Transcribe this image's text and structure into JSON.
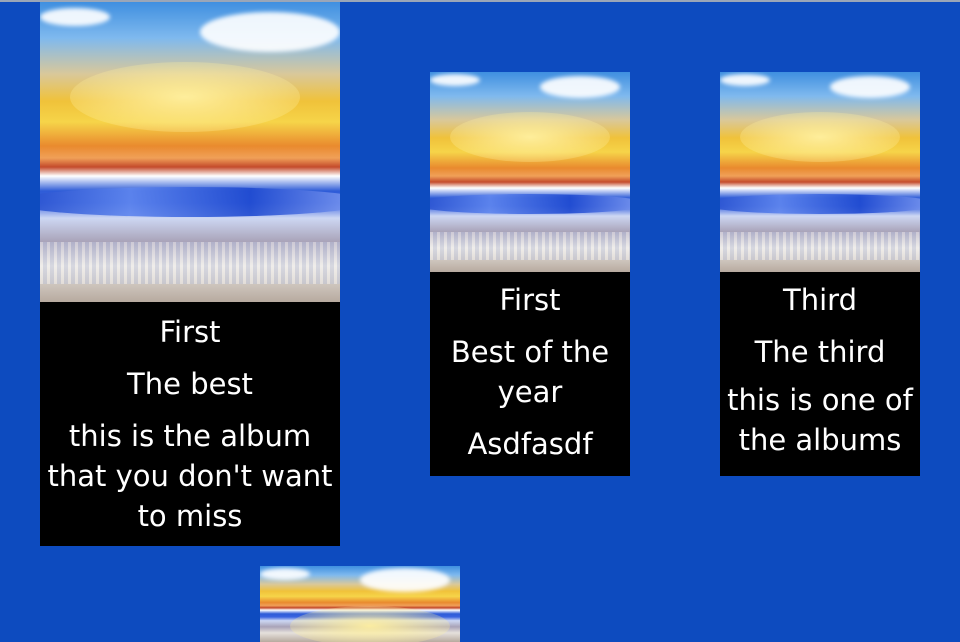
{
  "albums": [
    {
      "title": "First",
      "subtitle": "The best",
      "description": "this is the album that you don't want to miss"
    },
    {
      "title": "First",
      "subtitle": "Best of the year",
      "description": "Asdfasdf"
    },
    {
      "title": "Third",
      "subtitle": "The third",
      "description": "this is one of the albums"
    },
    {
      "title": "",
      "subtitle": "",
      "description": ""
    }
  ]
}
